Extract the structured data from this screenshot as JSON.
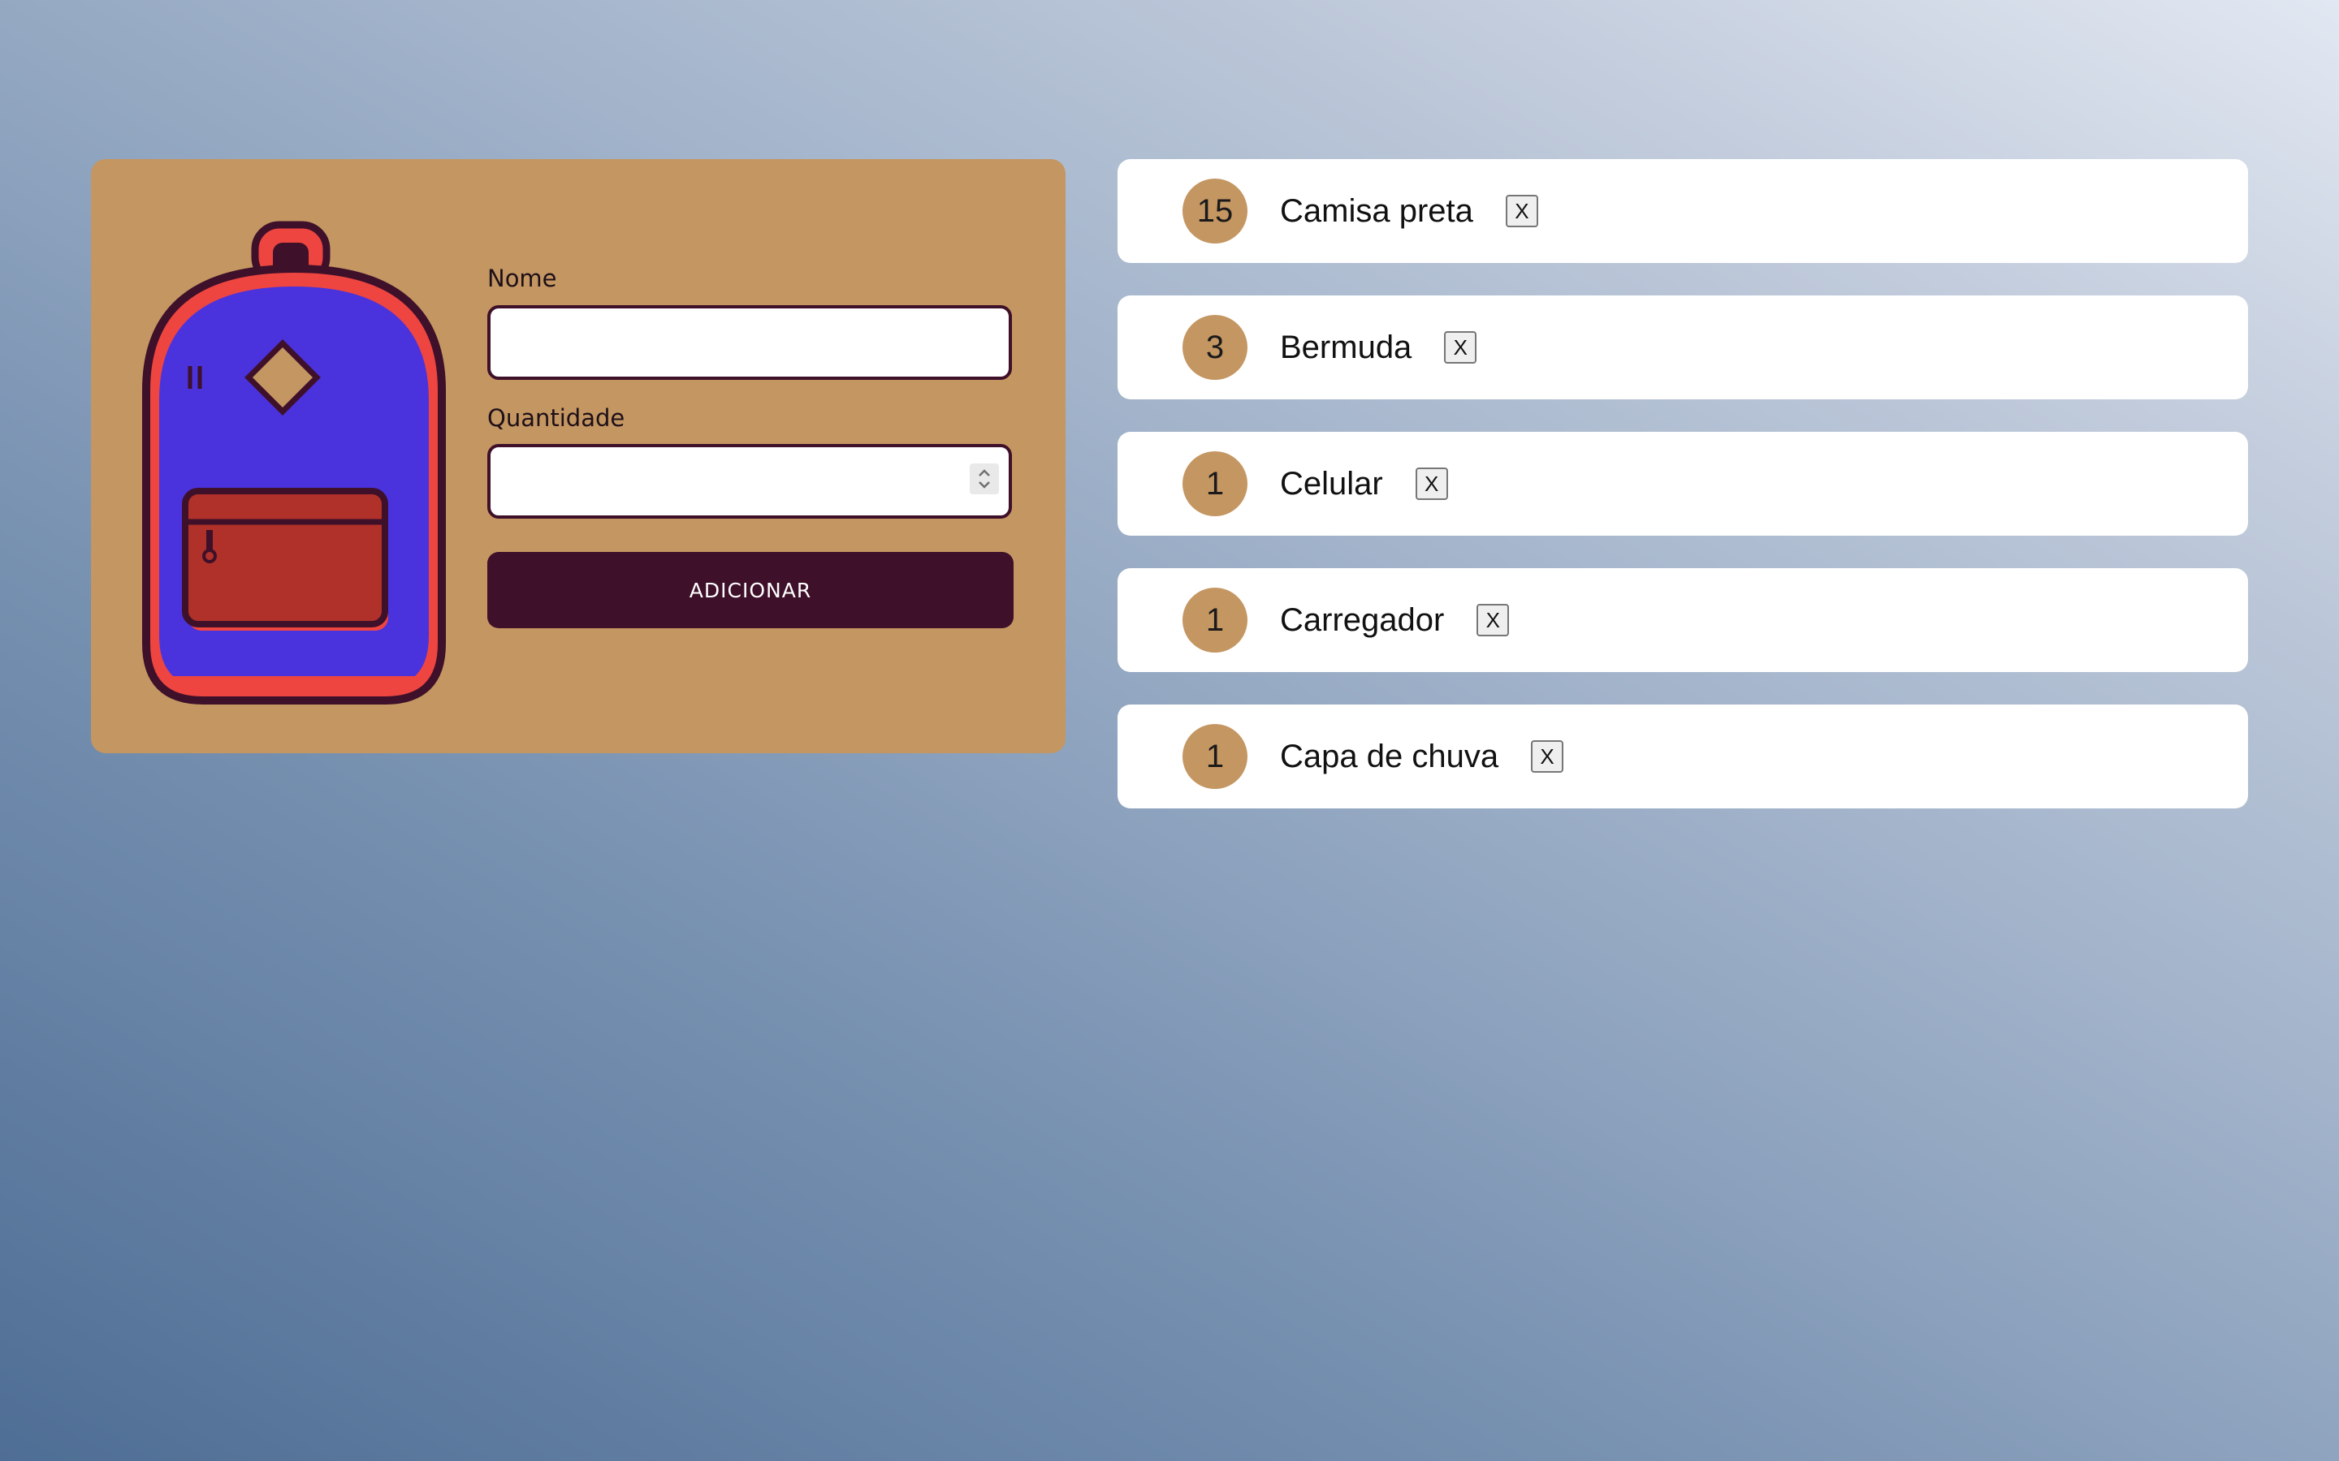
{
  "form": {
    "name_label": "Nome",
    "name_value": "",
    "quantity_label": "Quantidade",
    "quantity_value": "",
    "submit_label": "ADICIONAR"
  },
  "illustration": {
    "icon": "backpack-icon",
    "colors": {
      "body": "#4a33dc",
      "rim": "#ee4540",
      "outline": "#3e1029",
      "pocket": "#b03129",
      "patch": "#c49662"
    }
  },
  "items": [
    {
      "quantity": "15",
      "name": "Camisa preta",
      "delete_label": "X"
    },
    {
      "quantity": "3",
      "name": "Bermuda",
      "delete_label": "X"
    },
    {
      "quantity": "1",
      "name": "Celular",
      "delete_label": "X"
    },
    {
      "quantity": "1",
      "name": "Carregador",
      "delete_label": "X"
    },
    {
      "quantity": "1",
      "name": "Capa de chuva",
      "delete_label": "X"
    }
  ],
  "colors": {
    "card": "#c49662",
    "accent": "#3e1029",
    "item_card": "#ffffff",
    "background_light": "#e2e8f2",
    "background_dark": "#4f6e95"
  }
}
